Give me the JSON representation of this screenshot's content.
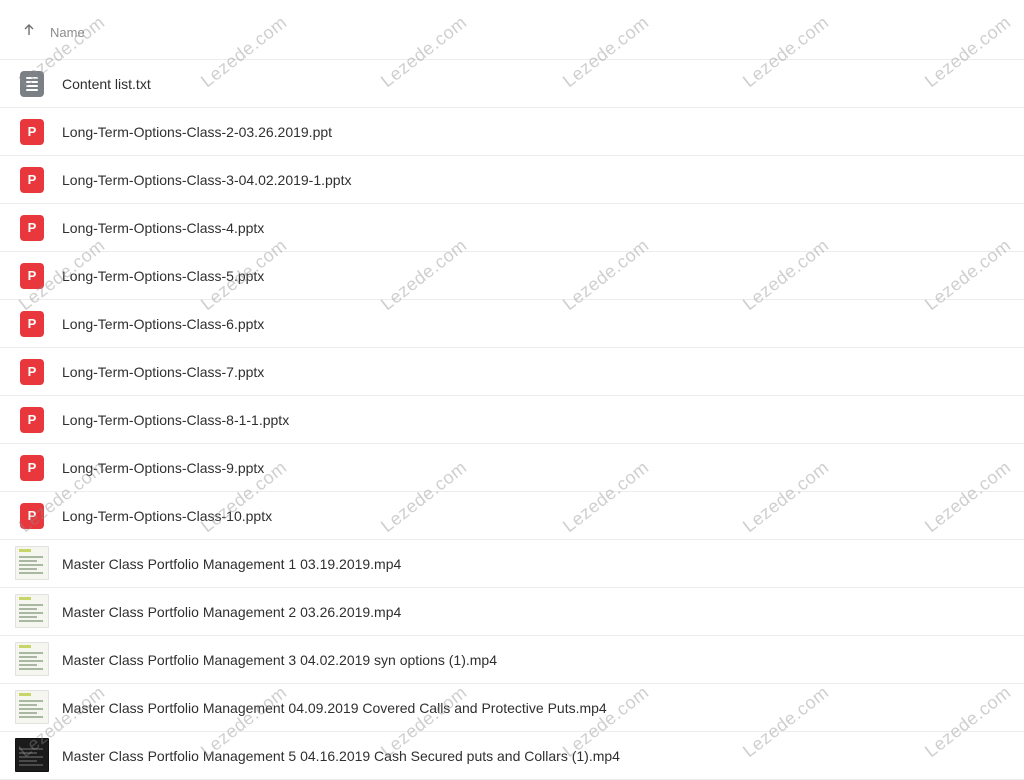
{
  "header": {
    "sort_icon": "arrow-up-icon",
    "column_name": "Name"
  },
  "files": [
    {
      "name": "Content list.txt",
      "type": "txt",
      "icon": "text-file-icon"
    },
    {
      "name": "Long-Term-Options-Class-2-03.26.2019.ppt",
      "type": "ppt",
      "icon": "powerpoint-icon"
    },
    {
      "name": "Long-Term-Options-Class-3-04.02.2019-1.pptx",
      "type": "ppt",
      "icon": "powerpoint-icon"
    },
    {
      "name": "Long-Term-Options-Class-4.pptx",
      "type": "ppt",
      "icon": "powerpoint-icon"
    },
    {
      "name": "Long-Term-Options-Class-5.pptx",
      "type": "ppt",
      "icon": "powerpoint-icon"
    },
    {
      "name": "Long-Term-Options-Class-6.pptx",
      "type": "ppt",
      "icon": "powerpoint-icon"
    },
    {
      "name": "Long-Term-Options-Class-7.pptx",
      "type": "ppt",
      "icon": "powerpoint-icon"
    },
    {
      "name": "Long-Term-Options-Class-8-1-1.pptx",
      "type": "ppt",
      "icon": "powerpoint-icon"
    },
    {
      "name": "Long-Term-Options-Class-9.pptx",
      "type": "ppt",
      "icon": "powerpoint-icon"
    },
    {
      "name": "Long-Term-Options-Class-10.pptx",
      "type": "ppt",
      "icon": "powerpoint-icon"
    },
    {
      "name": "Master Class Portfolio Management 1 03.19.2019.mp4",
      "type": "mp4",
      "icon": "video-thumbnail"
    },
    {
      "name": "Master Class Portfolio Management 2 03.26.2019.mp4",
      "type": "mp4",
      "icon": "video-thumbnail"
    },
    {
      "name": "Master Class Portfolio Management 3 04.02.2019 syn options (1).mp4",
      "type": "mp4",
      "icon": "video-thumbnail"
    },
    {
      "name": "Master Class Portfolio Management 04.09.2019 Covered Calls and Protective Puts.mp4",
      "type": "mp4",
      "icon": "video-thumbnail"
    },
    {
      "name": "Master Class Portfolio Management 5 04.16.2019 Cash Secured puts and Collars (1).mp4",
      "type": "mp4",
      "icon": "video-thumbnail-dark"
    }
  ],
  "watermark": "Lezede.com",
  "colors": {
    "powerpoint": "#e8383d",
    "text_file": "#7b7f86",
    "divider": "#ececec"
  }
}
